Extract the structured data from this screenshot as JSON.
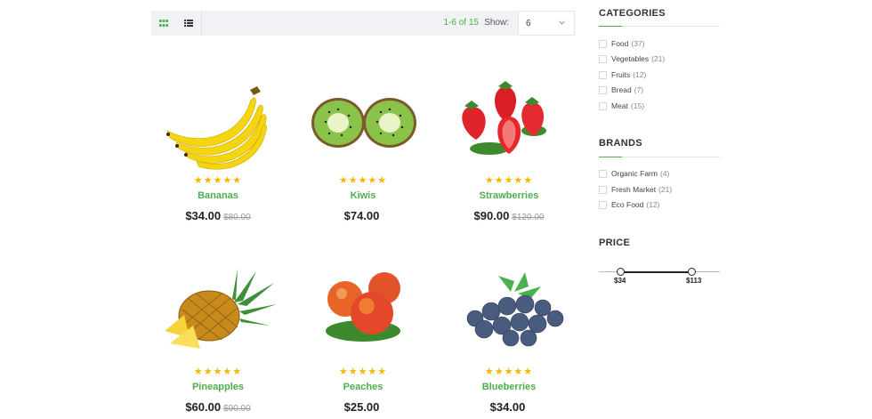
{
  "toolbar": {
    "grid_icon": "grid-view-icon",
    "list_icon": "list-view-icon",
    "result_count": "1-6 of 15",
    "show_label": "Show:",
    "per_page_value": "6",
    "colors": {
      "active": "#4cae4c",
      "bar": "#f1f2f5"
    }
  },
  "products": [
    {
      "name": "Bananas",
      "stars": "★★★★★",
      "price": "$34.00",
      "old_price": "$80.00",
      "rating": 4.5
    },
    {
      "name": "Kiwis",
      "stars": "★★★★★",
      "price": "$74.00",
      "old_price": "",
      "rating": 4.5
    },
    {
      "name": "Strawberries",
      "stars": "★★★★★",
      "price": "$90.00",
      "old_price": "$120.00",
      "rating": 4.5
    },
    {
      "name": "Pineapples",
      "stars": "★★★★★",
      "price": "$60.00",
      "old_price": "$90.00",
      "rating": 4.5
    },
    {
      "name": "Peaches",
      "stars": "★★★★★",
      "price": "$25.00",
      "old_price": "",
      "rating": 4.5
    },
    {
      "name": "Blueberries",
      "stars": "★★★★★",
      "price": "$34.00",
      "old_price": "",
      "rating": 4.5
    }
  ],
  "sidebar": {
    "categories_title": "CATEGORIES",
    "categories": [
      {
        "label": "Food",
        "count": "(37)"
      },
      {
        "label": "Vegetables",
        "count": "(21)"
      },
      {
        "label": "Fruits",
        "count": "(12)"
      },
      {
        "label": "Bread",
        "count": "(7)"
      },
      {
        "label": "Meat",
        "count": "(15)"
      }
    ],
    "brands_title": "BRANDS",
    "brands": [
      {
        "label": "Organic Farm",
        "count": "(4)"
      },
      {
        "label": "Fresh Market",
        "count": "(21)"
      },
      {
        "label": "Eco Food",
        "count": "(12)"
      }
    ],
    "price_title": "PRICE",
    "price_min": "$34",
    "price_max": "$113"
  }
}
